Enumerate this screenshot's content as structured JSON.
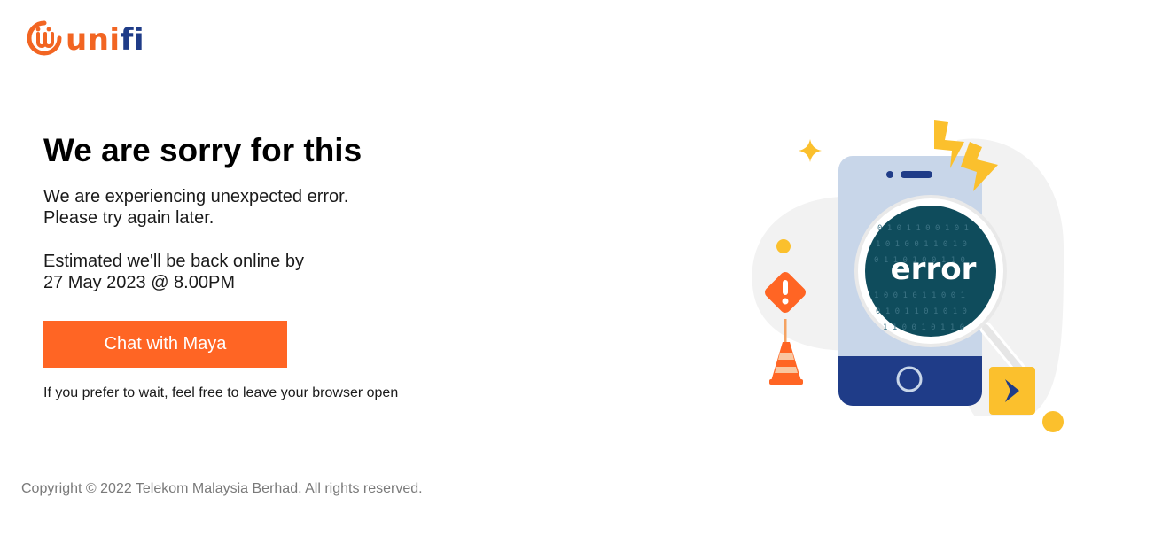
{
  "brand": {
    "name_part1": "uni",
    "name_part2": "fi",
    "logo_icon": "unifi-logo-icon",
    "colors": {
      "orange": "#f26522",
      "blue": "#1f3c88"
    }
  },
  "main": {
    "headline": "We are sorry for this",
    "message_line1": "We are experiencing unexpected error.",
    "message_line2": "Please try again later.",
    "eta_line1": "Estimated we'll be back online by",
    "eta_line2": "27 May 2023 @ 8.00PM",
    "chat_button_label": "Chat with Maya",
    "wait_note": "If you prefer to wait, feel free to leave your browser open"
  },
  "illustration": {
    "error_label": "error",
    "icons": [
      "phone-icon",
      "magnifier-icon",
      "warning-sign-icon",
      "traffic-cone-icon",
      "lightning-icon",
      "sparkle-icon",
      "chevron-right-icon"
    ],
    "colors": {
      "accent": "#ff6524",
      "yellow": "#fbc02d",
      "navy": "#1f3c88",
      "teal_dark": "#0f4c5c"
    }
  },
  "footer": {
    "copyright": "Copyright © 2022 Telekom Malaysia Berhad. All rights reserved."
  }
}
